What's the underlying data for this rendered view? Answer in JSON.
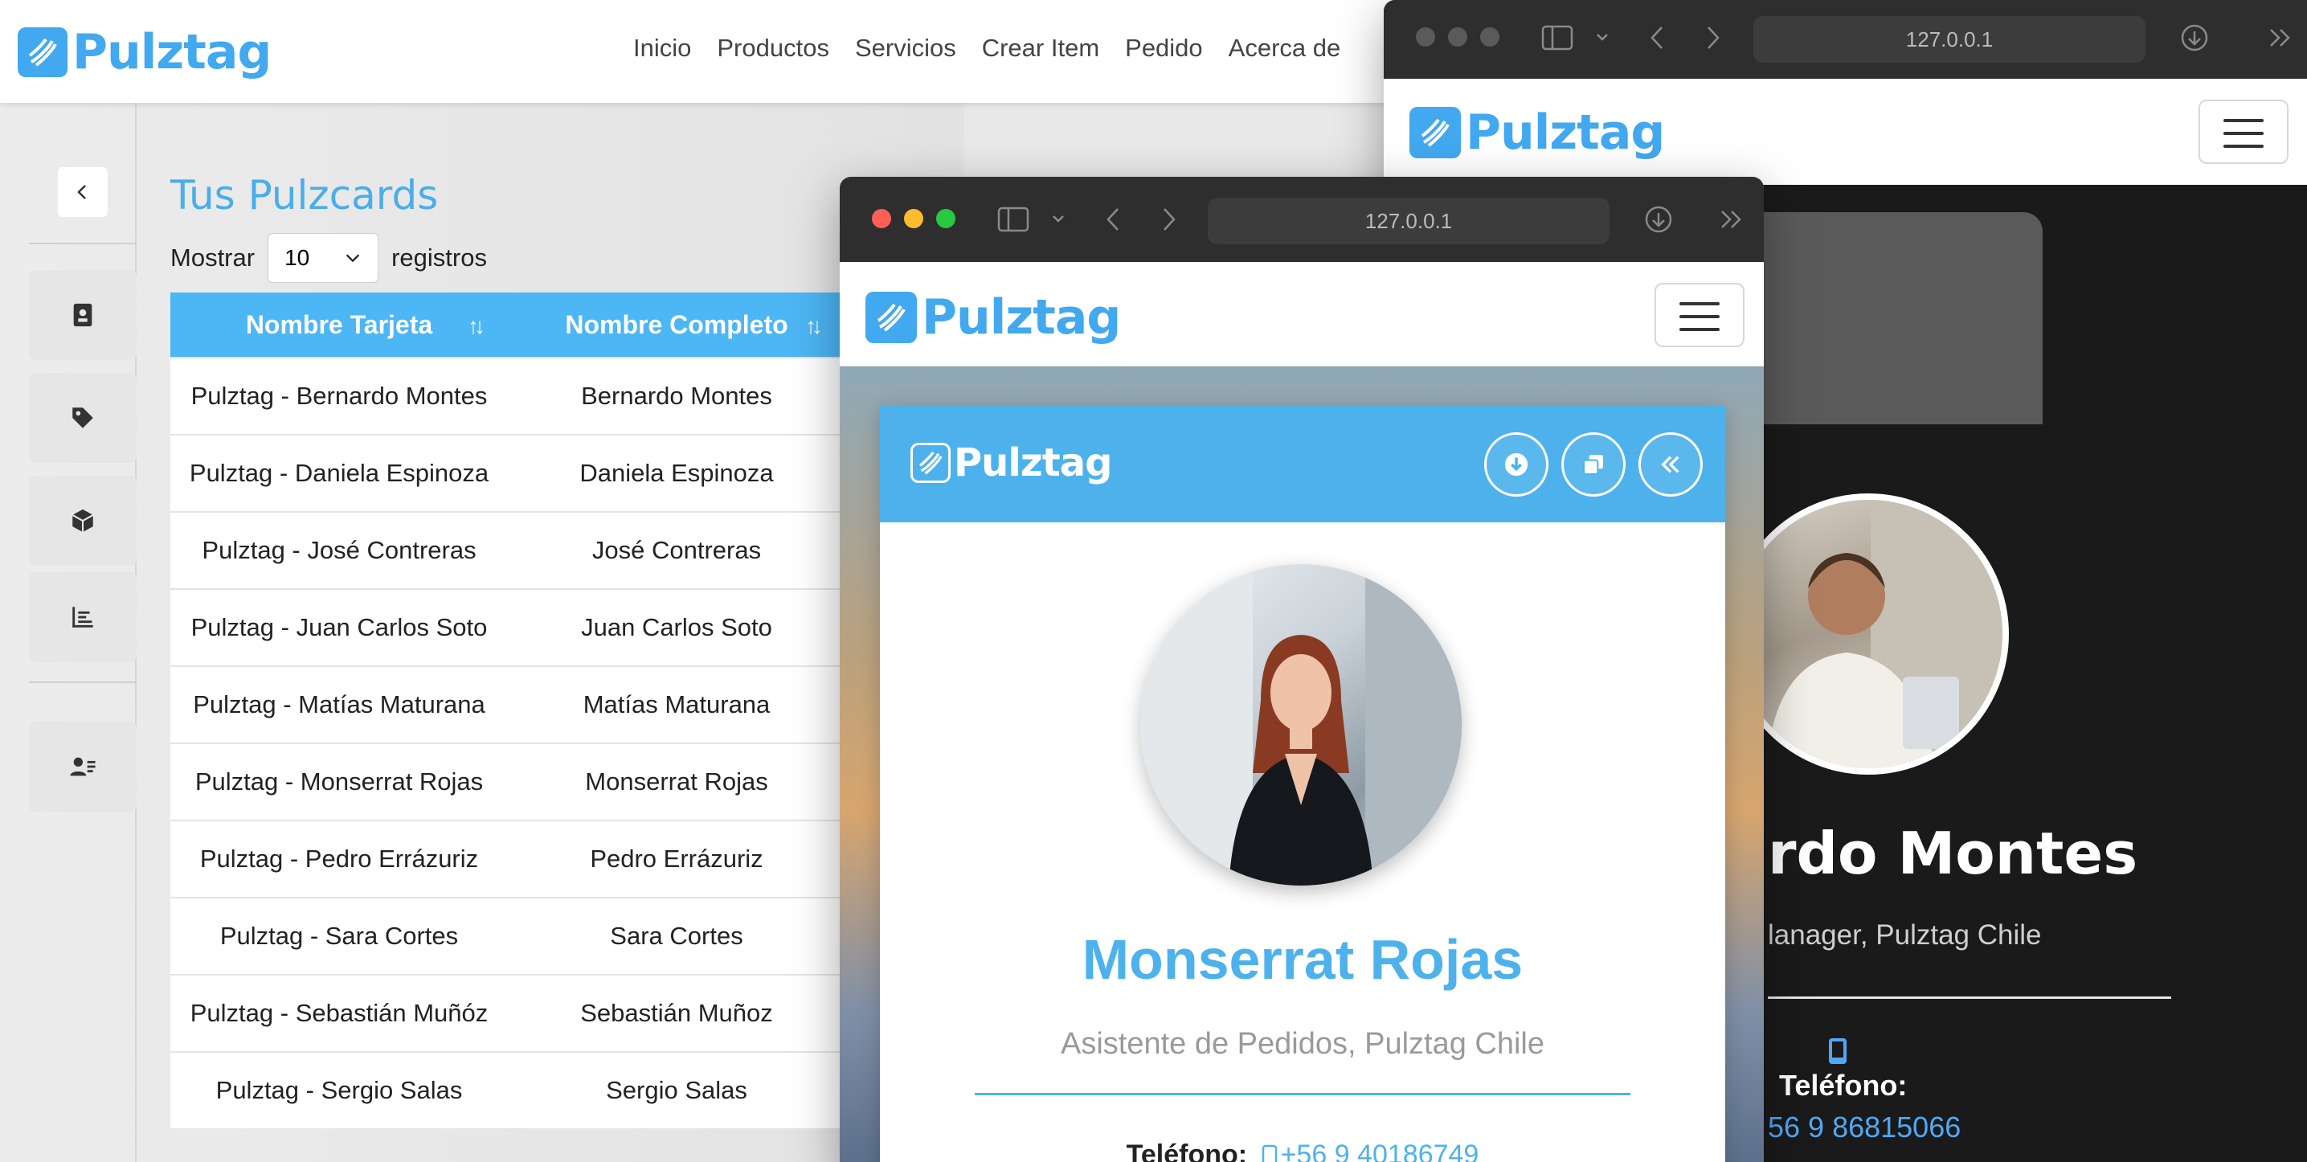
{
  "brand": {
    "name": "Pulztag",
    "color": "#42a8ef"
  },
  "topnav": {
    "links": [
      "Inicio",
      "Productos",
      "Servicios",
      "Crear Item",
      "Pedido",
      "Acerca de"
    ]
  },
  "sidebar": {
    "items": [
      {
        "icon": "contact-card-icon"
      },
      {
        "icon": "tag-icon"
      },
      {
        "icon": "box-icon"
      },
      {
        "icon": "bar-chart-icon"
      },
      {
        "icon": "user-list-icon"
      }
    ]
  },
  "main": {
    "title": "Tus Pulzcards",
    "show_label": "Mostrar",
    "show_value": "10",
    "records_label": "registros",
    "columns": [
      "Nombre Tarjeta",
      "Nombre Completo"
    ],
    "rows": [
      [
        "Pulztag - Bernardo Montes",
        "Bernardo Montes"
      ],
      [
        "Pulztag - Daniela Espinoza",
        "Daniela Espinoza"
      ],
      [
        "Pulztag - José Contreras",
        "José Contreras"
      ],
      [
        "Pulztag - Juan Carlos Soto",
        "Juan Carlos Soto"
      ],
      [
        "Pulztag - Matías Maturana",
        "Matías Maturana"
      ],
      [
        "Pulztag - Monserrat Rojas",
        "Monserrat Rojas"
      ],
      [
        "Pulztag - Pedro Errázuriz",
        "Pedro Errázuriz"
      ],
      [
        "Pulztag - Sara Cortes",
        "Sara Cortes"
      ],
      [
        "Pulztag - Sebastián Muñóz",
        "Sebastián Muñoz"
      ],
      [
        "Pulztag - Sergio Salas",
        "Sergio Salas"
      ]
    ]
  },
  "browser_right": {
    "url": "127.0.0.1",
    "name_visible": "rdo Montes",
    "role_visible": "lanager, Pulztag Chile",
    "phone_label": "Teléfono:",
    "phone_visible": "56 9 86815066"
  },
  "browser_mid": {
    "url": "127.0.0.1",
    "card": {
      "name": "Monserrat Rojas",
      "role": "Asistente de Pedidos, Pulztag Chile",
      "phone_label": "Teléfono:",
      "phone": "+56 9 40186749"
    }
  },
  "colors": {
    "accent": "#4db2ec",
    "table_header": "#4db6f5",
    "dark_card": "#1a1a1a"
  }
}
